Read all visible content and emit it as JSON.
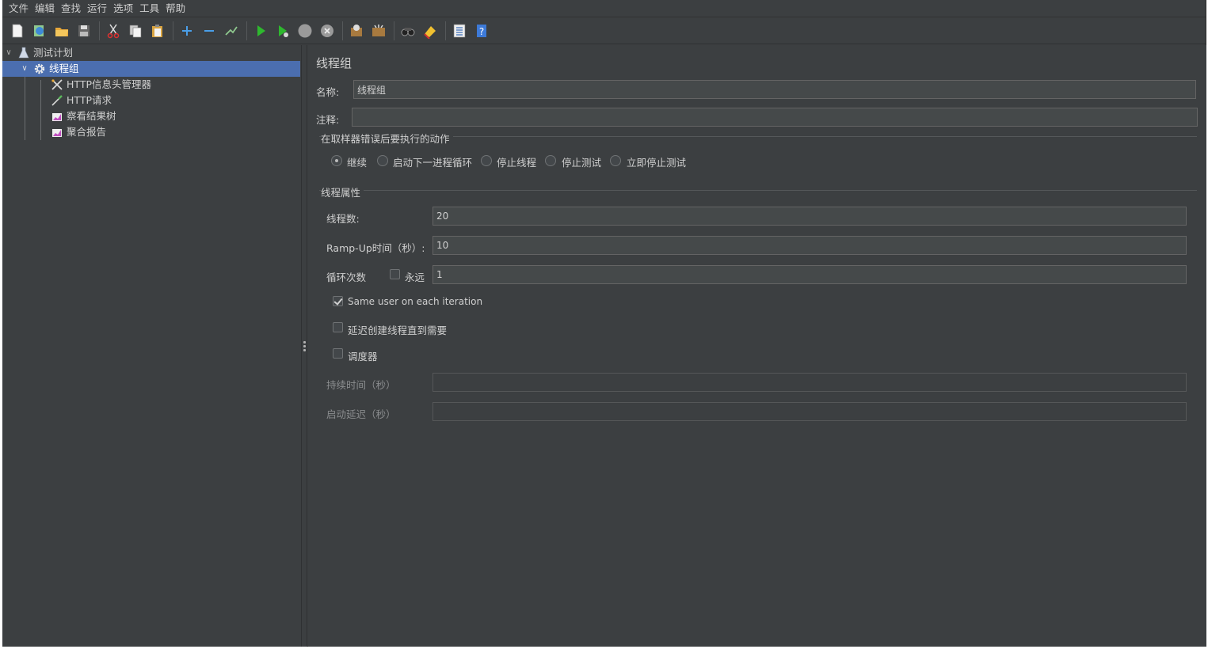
{
  "menubar": {
    "items": [
      "文件",
      "编辑",
      "查找",
      "运行",
      "选项",
      "工具",
      "帮助"
    ]
  },
  "toolbar": {
    "buttons": [
      "new-icon",
      "templates-icon",
      "open-icon",
      "save-icon",
      "cut-icon",
      "copy-icon",
      "paste-icon",
      "expand-icon",
      "collapse-icon",
      "toggle-icon",
      "start-icon",
      "start-no-pause-icon",
      "stop-icon",
      "shutdown-icon",
      "clear-icon",
      "clear-all-icon",
      "search-icon",
      "reset-search-icon",
      "function-helper-icon",
      "help-icon"
    ]
  },
  "tree": {
    "root": "测试计划",
    "thread_group": "线程组",
    "children": [
      "HTTP信息头管理器",
      "HTTP请求",
      "察看结果树",
      "聚合报告"
    ]
  },
  "panel": {
    "title": "线程组",
    "name_label": "名称:",
    "name_value": "线程组",
    "comment_label": "注释:",
    "comment_value": "",
    "error_section": "在取样器错误后要执行的动作",
    "error_options": [
      "继续",
      "启动下一进程循环",
      "停止线程",
      "停止测试",
      "立即停止测试"
    ],
    "error_selected": "继续",
    "props_section": "线程属性",
    "threads_label": "线程数:",
    "threads_value": "20",
    "rampup_label": "Ramp-Up时间（秒）:",
    "rampup_value": "10",
    "loop_label": "循环次数",
    "forever_label": "永远",
    "forever_checked": false,
    "loop_value": "1",
    "same_user_label": "Same user on each iteration",
    "same_user_checked": true,
    "delay_label": "延迟创建线程直到需要",
    "delay_checked": false,
    "scheduler_label": "调度器",
    "scheduler_checked": false,
    "duration_label": "持续时间（秒）",
    "duration_value": "",
    "startup_delay_label": "启动延迟（秒）",
    "startup_delay_value": ""
  },
  "colors": {
    "background": "#3c3f41",
    "selection": "#4b6eaf",
    "field": "#45494a"
  }
}
